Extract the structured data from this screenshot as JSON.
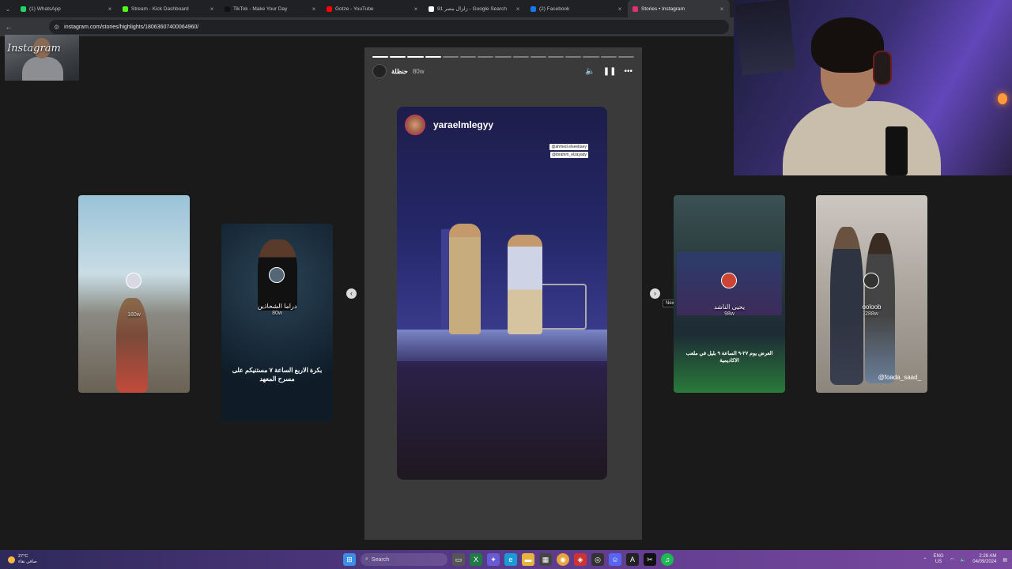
{
  "browser": {
    "tabs": [
      {
        "title": "(1) WhatsApp",
        "color": "#25d366",
        "active": false
      },
      {
        "title": "Stream - Kick Dashboard",
        "color": "#53fc18",
        "active": false
      },
      {
        "title": "TikTok - Make Your Day",
        "color": "#111111",
        "active": false
      },
      {
        "title": "Gotze - YouTube",
        "color": "#ff0000",
        "active": false
      },
      {
        "title": "زلزال مصر 91 - Google Search",
        "color": "#ffffff",
        "active": false
      },
      {
        "title": "(2) Facebook",
        "color": "#1877f2",
        "active": false
      },
      {
        "title": "Stories • Instagram",
        "color": "#e1306c",
        "active": true
      }
    ],
    "url": "instagram.com/stories/highlights/18063607400064960/"
  },
  "webcam_small": {
    "overlay_text": "Instagram"
  },
  "stories": {
    "viewer": {
      "username": "حنظلة",
      "time": "80w",
      "progress_total": 15,
      "progress_done": 4,
      "poster_username": "yaraelmlegyy",
      "mentions": [
        "@ahmed.elseebaey",
        "@ibrahim_elzayady"
      ]
    },
    "prev_cards": [
      {
        "label": "",
        "age": "180w",
        "caption": ""
      },
      {
        "label": "دراما الشحاذين",
        "age": "80w",
        "caption": "بكرة الاربع الساعة ٧ مستنيكم على مسرح المعهد"
      }
    ],
    "next_cards": [
      {
        "label": "يحيى الناشد",
        "age": "98w",
        "caption": "العرض يوم ٢٧-٩ الساعة ٩ بليل في ملعب الاكاديمية"
      },
      {
        "label": "ooloob",
        "age": "288w",
        "caption": "@foada_saad_"
      }
    ],
    "next_tooltip": "Next"
  },
  "taskbar": {
    "weather_temp": "27°C",
    "weather_desc": "صافي نقاء",
    "search_placeholder": "Search",
    "lang_top": "ENG",
    "lang_bottom": "US",
    "time": "2:28 AM",
    "date": "04/09/2024"
  }
}
